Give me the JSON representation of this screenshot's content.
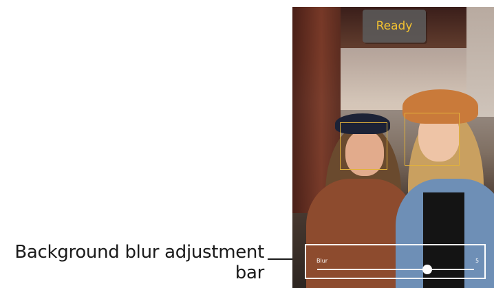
{
  "callout": {
    "label": "Background blur adjustment bar"
  },
  "status": {
    "label": "Ready",
    "color": "#f2c230"
  },
  "blur_control": {
    "label": "Blur",
    "value_label": "5",
    "slider_fraction": 0.7
  },
  "colors": {
    "face_box": "#e3b23a",
    "panel_border": "#ffffff"
  }
}
